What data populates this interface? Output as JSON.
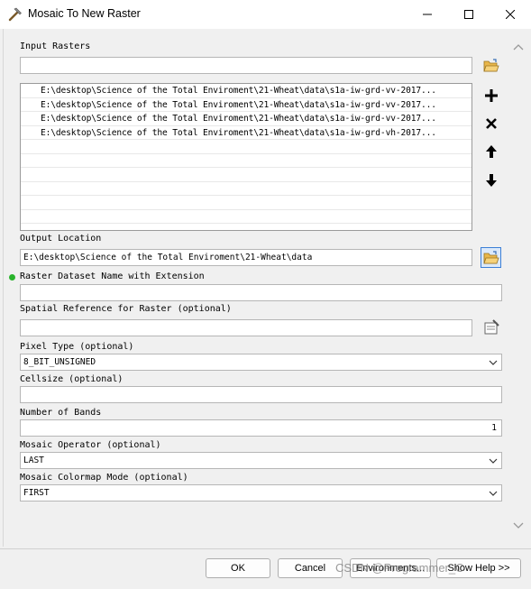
{
  "window": {
    "title": "Mosaic To New Raster"
  },
  "input_rasters": {
    "label": "Input Rasters",
    "value": "",
    "items": [
      "E:\\desktop\\Science of the Total Enviroment\\21-Wheat\\data\\s1a-iw-grd-vv-2017...",
      "E:\\desktop\\Science of the Total Enviroment\\21-Wheat\\data\\s1a-iw-grd-vv-2017...",
      "E:\\desktop\\Science of the Total Enviroment\\21-Wheat\\data\\s1a-iw-grd-vv-2017...",
      "E:\\desktop\\Science of the Total Enviroment\\21-Wheat\\data\\s1a-iw-grd-vh-2017..."
    ]
  },
  "output_location": {
    "label": "Output Location",
    "value": "E:\\desktop\\Science of the Total Enviroment\\21-Wheat\\data"
  },
  "raster_name": {
    "label": "Raster Dataset Name with Extension",
    "value": ""
  },
  "spatial_ref": {
    "label": "Spatial Reference for Raster (optional)",
    "value": ""
  },
  "pixel_type": {
    "label": "Pixel Type (optional)",
    "value": "8_BIT_UNSIGNED"
  },
  "cellsize": {
    "label": "Cellsize (optional)",
    "value": ""
  },
  "num_bands": {
    "label": "Number of Bands",
    "value": "1"
  },
  "mosaic_operator": {
    "label": "Mosaic Operator (optional)",
    "value": "LAST"
  },
  "colormap_mode": {
    "label": "Mosaic Colormap Mode (optional)",
    "value": "FIRST"
  },
  "buttons": {
    "ok": "OK",
    "cancel": "Cancel",
    "environments": "Environments...",
    "help": "Show Help >>"
  },
  "watermark": "CSDN @Programmer_C",
  "colors": {
    "required_dot": "#29b32c",
    "folder": "#e8b64a"
  }
}
